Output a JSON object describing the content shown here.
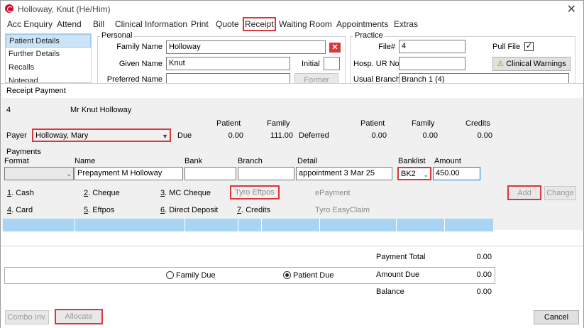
{
  "window": {
    "title": "Holloway, Knut (He/Him)"
  },
  "menu": [
    "Acc Enquiry",
    "Attend",
    "Bill",
    "Clinical Information",
    "Print",
    "Quote",
    "Receipt",
    "Waiting Room",
    "Appointments",
    "Extras"
  ],
  "nav": [
    "Patient Details",
    "Further Details",
    "Recalls",
    "Notepad"
  ],
  "personal": {
    "group": "Personal",
    "family_name_label": "Family Name",
    "family_name": "Holloway",
    "given_name_label": "Given Name",
    "given_name": "Knut",
    "initial_label": "Initial",
    "initial": "",
    "preferred_name_label": "Preferred Name",
    "former_button": "Former"
  },
  "practice": {
    "group": "Practice",
    "file_label": "File#",
    "file_value": "4",
    "pull_file_label": "Pull File",
    "pull_file_checked": "✓",
    "hosp_ur_label": "Hosp. UR No",
    "hosp_ur_value": "",
    "clinical_warnings_button": "Clinical Warnings",
    "usual_branch_label": "Usual Branch",
    "usual_branch_value": "Branch 1 (4)"
  },
  "receipt": {
    "title": "Receipt Payment",
    "patient_id": "4",
    "patient_name": "Mr Knut Holloway",
    "payer_label": "Payer",
    "payer_value": "Holloway, Mary",
    "due_label": "Due",
    "deferred_label": "Deferred",
    "headers": [
      "Patient",
      "Family",
      "Patient",
      "Family",
      "Credits"
    ],
    "due_patient": "0.00",
    "due_family": "111.00",
    "deferred_patient": "0.00",
    "deferred_family": "0.00",
    "credits": "0.00",
    "payments_group": "Payments",
    "col_format": "Format",
    "col_name": "Name",
    "col_bank": "Bank",
    "col_branch": "Branch",
    "col_detail": "Detail",
    "col_banklist": "Banklist",
    "col_amount": "Amount",
    "format_value": "",
    "name_value": "Prepayment M Holloway",
    "bank_value": "",
    "branch_value": "",
    "detail_value": "appointment 3 Mar 25",
    "banklist_value": "BK2",
    "amount_value": "450.00",
    "methods_row1": [
      {
        "key": "1",
        "label": ". Cash"
      },
      {
        "key": "2",
        "label": ". Cheque"
      },
      {
        "key": "3",
        "label": ". MC Cheque"
      }
    ],
    "tyro_eftpos": "Tyro Eftpos",
    "epayment": "ePayment",
    "methods_row2": [
      {
        "key": "4",
        "label": ". Card"
      },
      {
        "key": "5",
        "label": ". Eftpos"
      },
      {
        "key": "6",
        "label": ". Direct Deposit"
      },
      {
        "key": "7",
        "label": ". Credits"
      }
    ],
    "tyro_easyclaim": "Tyro EasyClaim",
    "add_button": "Add",
    "change_button": "Change",
    "payment_total_label": "Payment Total",
    "payment_total": "0.00",
    "family_due_label": "Family Due",
    "patient_due_label": "Patient Due",
    "amount_due_label": "Amount Due",
    "amount_due": "0.00",
    "balance_label": "Balance",
    "balance": "0.00",
    "combo_inv_button": "Combo Inv.",
    "allocate_button": "Allocate",
    "cancel_button": "Cancel"
  },
  "colors": {
    "highlight": "#d9363e",
    "selection": "#cce4f7",
    "grid_row": "#a9d5f5"
  }
}
